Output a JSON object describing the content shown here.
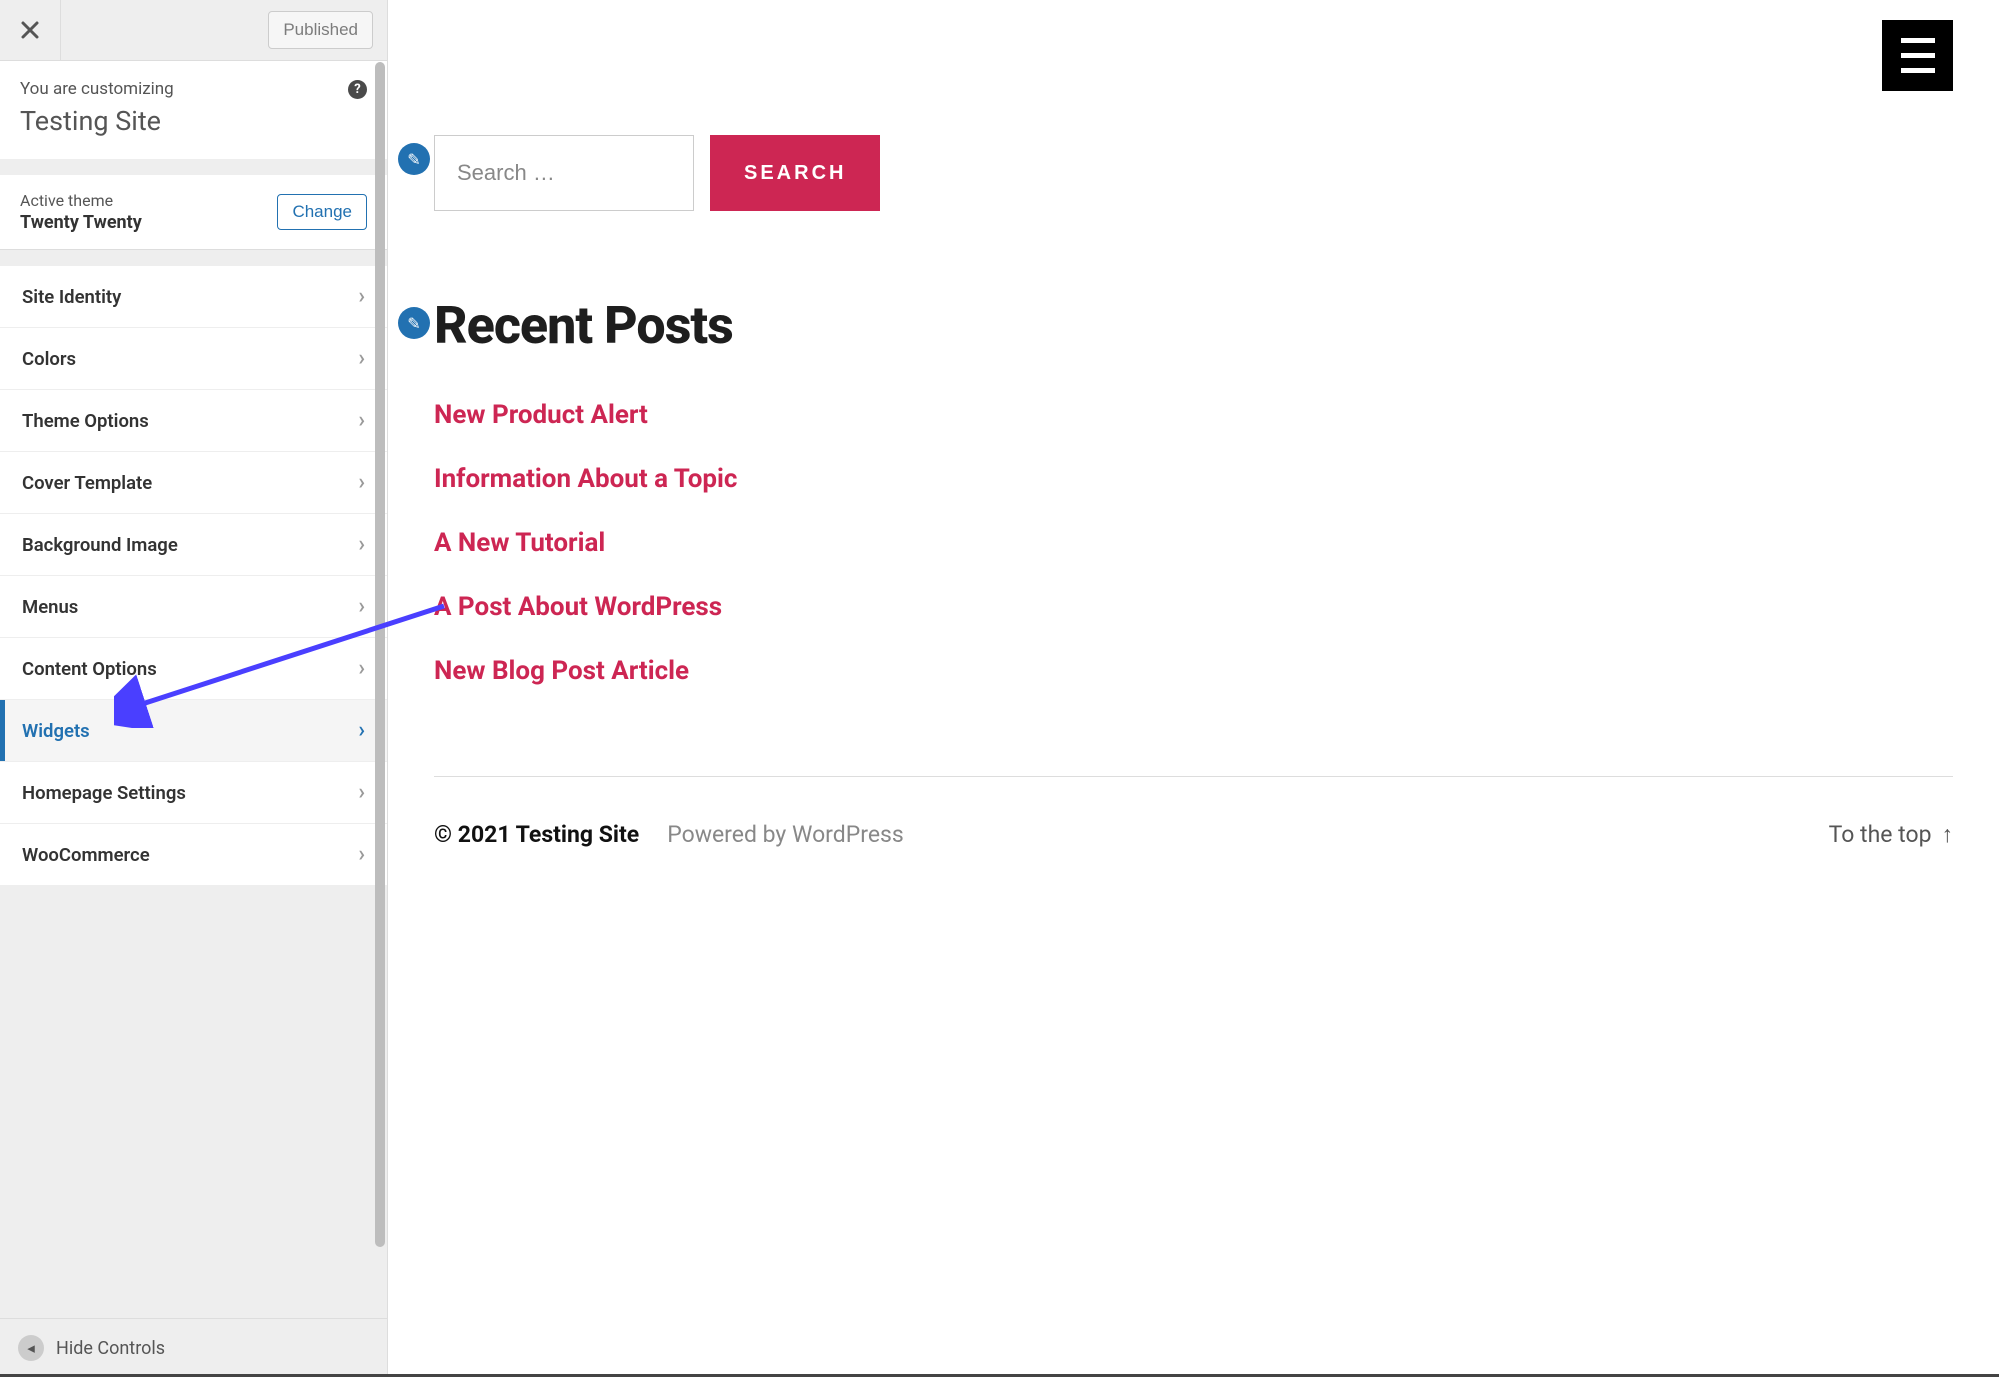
{
  "sidebar": {
    "published_label": "Published",
    "customizing_label": "You are customizing",
    "site_title": "Testing Site",
    "active_theme_label": "Active theme",
    "active_theme_name": "Twenty Twenty",
    "change_label": "Change",
    "items": [
      {
        "label": "Site Identity"
      },
      {
        "label": "Colors"
      },
      {
        "label": "Theme Options"
      },
      {
        "label": "Cover Template"
      },
      {
        "label": "Background Image"
      },
      {
        "label": "Menus"
      },
      {
        "label": "Content Options"
      },
      {
        "label": "Widgets"
      },
      {
        "label": "Homepage Settings"
      },
      {
        "label": "WooCommerce"
      }
    ],
    "active_index": 7,
    "hide_controls_label": "Hide Controls"
  },
  "icons": {
    "help_glyph": "?",
    "chevron_glyph": "›",
    "hide_glyph": "◂",
    "pencil_glyph": "✎",
    "up_arrow_glyph": "↑"
  },
  "preview": {
    "search_placeholder": "Search …",
    "search_button": "SEARCH",
    "recent_posts_title": "Recent Posts",
    "posts": [
      {
        "title": "New Product Alert"
      },
      {
        "title": "Information About a Topic"
      },
      {
        "title": "A New Tutorial"
      },
      {
        "title": "A Post About WordPress"
      },
      {
        "title": "New Blog Post Article"
      }
    ],
    "footer": {
      "copyright": "© 2021 Testing Site",
      "powered": "Powered by WordPress",
      "to_top": "To the top"
    }
  },
  "colors": {
    "accent": "#cd2653",
    "wp_blue": "#2271b1",
    "annotation_arrow": "#4a3fff"
  }
}
